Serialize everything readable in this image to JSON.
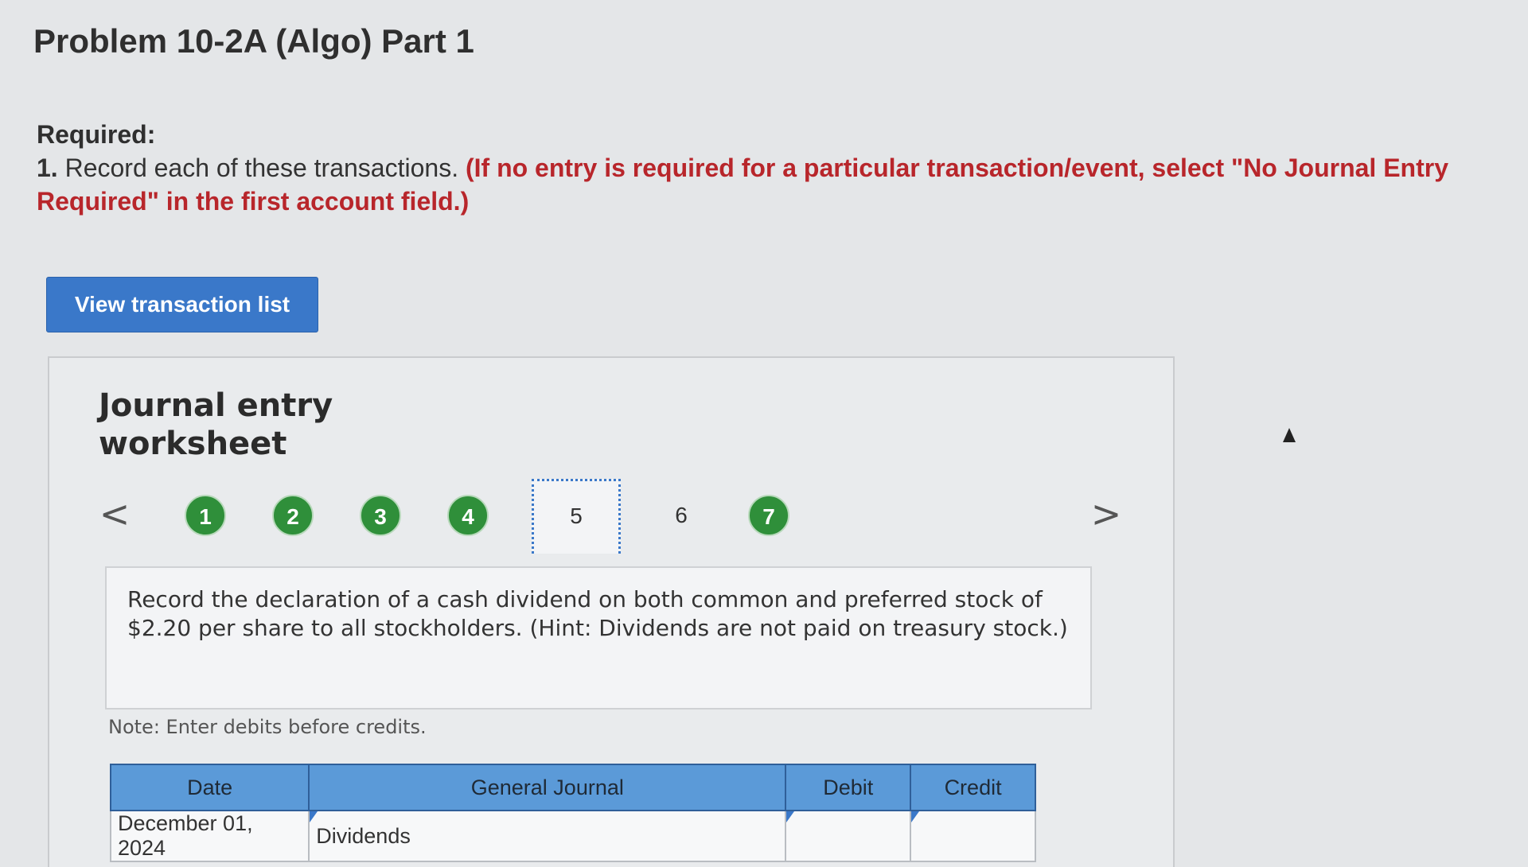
{
  "page": {
    "title": "Problem 10-2A (Algo) Part 1"
  },
  "required": {
    "heading": "Required:",
    "number": "1.",
    "text": " Record each of these transactions. ",
    "emphasis": "(If no entry is required for a particular transaction/event, select \"No Journal Entry Required\" in the first account field.)"
  },
  "toolbar": {
    "view_transactions_label": "View transaction list"
  },
  "worksheet": {
    "title": "Journal entry worksheet",
    "prev_label": "<",
    "next_label": ">",
    "steps": [
      {
        "label": "1",
        "state": "completed"
      },
      {
        "label": "2",
        "state": "completed"
      },
      {
        "label": "3",
        "state": "completed"
      },
      {
        "label": "4",
        "state": "completed"
      },
      {
        "label": "5",
        "state": "active"
      },
      {
        "label": "6",
        "state": "pending"
      },
      {
        "label": "7",
        "state": "completed"
      }
    ],
    "prompt": "Record the declaration of a cash dividend on both common and preferred stock of $2.20 per share to all stockholders. (Hint: Dividends are not paid on treasury stock.)",
    "note": "Note: Enter debits before credits.",
    "table": {
      "headers": [
        "Date",
        "General Journal",
        "Debit",
        "Credit"
      ],
      "rows": [
        {
          "date": "December 01, 2024",
          "account": "Dividends",
          "debit": "",
          "credit": ""
        }
      ]
    }
  },
  "colors": {
    "accent": "#3a78c9",
    "completed_step": "#2f8f3a",
    "instruction_red": "#b8262b",
    "table_header": "#5b9ad8"
  }
}
